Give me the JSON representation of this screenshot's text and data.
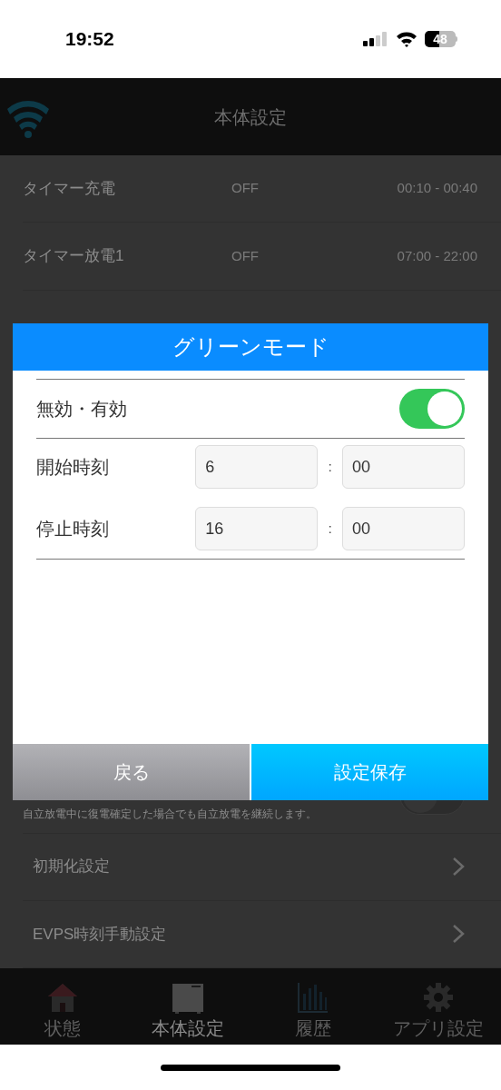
{
  "status_bar": {
    "time": "19:52",
    "battery": "48"
  },
  "header": {
    "title": "本体設定"
  },
  "settings": [
    {
      "kind": "timer",
      "label": "タイマー充電",
      "state": "OFF",
      "time": "00:10 - 00:40"
    },
    {
      "kind": "timer",
      "label": "タイマー放電1",
      "state": "OFF",
      "time": "07:00 - 22:00"
    },
    {
      "kind": "toggle",
      "description": "自立放電中に復電確定した場合でも自立放電を継続します。",
      "on": false
    },
    {
      "kind": "link",
      "label": "初期化設定"
    },
    {
      "kind": "link",
      "label": "EVPS時刻手動設定"
    }
  ],
  "dialog": {
    "title": "グリーンモード",
    "toggle": {
      "label": "無効・有効",
      "on": true
    },
    "time_rows": [
      {
        "label": "開始時刻",
        "hour": "6",
        "separator": ":",
        "minute": "00"
      },
      {
        "label": "停止時刻",
        "hour": "16",
        "separator": ":",
        "minute": "00"
      }
    ],
    "buttons": [
      {
        "kind": "back",
        "label": "戻る"
      },
      {
        "kind": "save",
        "label": "設定保存"
      }
    ]
  },
  "tab_bar": [
    {
      "label": "状態",
      "selected": false
    },
    {
      "label": "本体設定",
      "selected": true
    },
    {
      "label": "履歴",
      "selected": false
    },
    {
      "label": "アプリ設定",
      "selected": false
    }
  ]
}
